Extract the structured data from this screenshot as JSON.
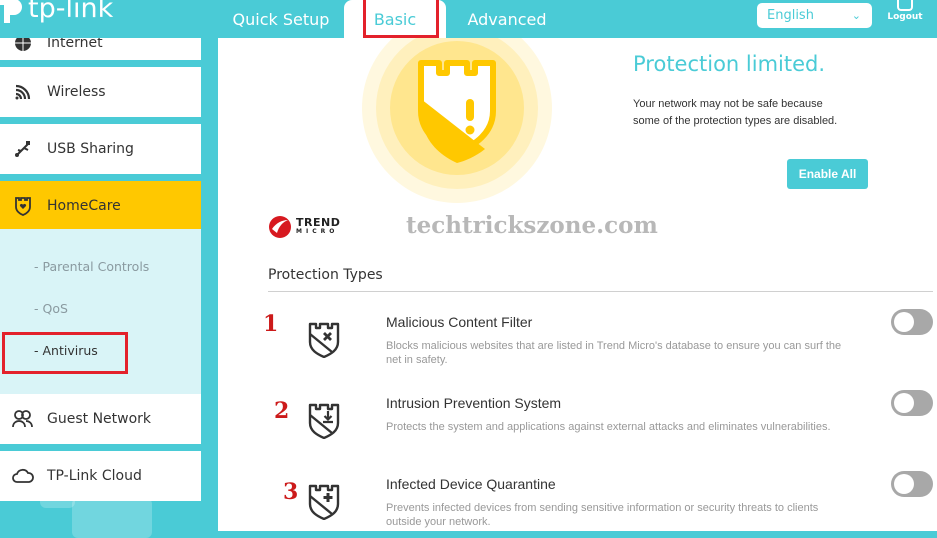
{
  "header": {
    "brand": "tp-link",
    "tabs": [
      {
        "label": "Quick Setup",
        "active": false
      },
      {
        "label": "Basic",
        "active": true
      },
      {
        "label": "Advanced",
        "active": false
      }
    ],
    "language": {
      "selected": "English"
    },
    "logout_label": "Logout"
  },
  "sidebar": {
    "items": [
      {
        "label": "Internet",
        "icon": "globe-icon"
      },
      {
        "label": "Wireless",
        "icon": "wifi-icon"
      },
      {
        "label": "USB Sharing",
        "icon": "usb-icon"
      },
      {
        "label": "HomeCare",
        "icon": "shield-heart-icon",
        "active": true
      },
      {
        "label": "Guest Network",
        "icon": "users-icon"
      },
      {
        "label": "TP-Link Cloud",
        "icon": "cloud-icon"
      }
    ],
    "sub_items": [
      {
        "label": "- Parental Controls",
        "current": false
      },
      {
        "label": "- QoS",
        "current": false
      },
      {
        "label": "- Antivirus",
        "current": true
      }
    ]
  },
  "main": {
    "status_title": "Protection limited.",
    "status_desc_line1": "Your network may not be safe because",
    "status_desc_line2": "some of the protection types are disabled.",
    "enable_all_label": "Enable All",
    "partner_logo": {
      "line1": "TREND",
      "line2": "MICRO"
    },
    "watermark": "techtrickszone.com",
    "types_title": "Protection Types",
    "protection_types": [
      {
        "number": "1",
        "name": "Malicious Content Filter",
        "desc": "Blocks malicious websites that are listed in Trend Micro's database to ensure you can surf the net in safety.",
        "enabled": false
      },
      {
        "number": "2",
        "name": "Intrusion Prevention System",
        "desc": "Protects the system and applications against external attacks and eliminates vulnerabilities.",
        "enabled": false
      },
      {
        "number": "3",
        "name": "Infected Device Quarantine",
        "desc": "Prevents infected devices from sending sensitive information or security threats to clients outside your network.",
        "enabled": false
      }
    ]
  },
  "colors": {
    "accent": "#4acbd6",
    "active_menu": "#ffc800",
    "annotation_red": "#e3212b"
  }
}
